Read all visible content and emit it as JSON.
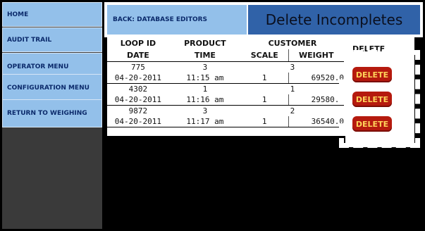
{
  "sidebar": {
    "items": [
      {
        "label": "HOME"
      },
      {
        "label": "AUDIT TRAIL"
      },
      {
        "label": "OPERATOR MENU"
      },
      {
        "label": "CONFIGURATION MENU"
      },
      {
        "label": "RETURN TO WEIGHING"
      }
    ]
  },
  "header": {
    "back_label": "BACK: DATABASE EDITORS",
    "title": "Delete Incompletes"
  },
  "table": {
    "headers_top": [
      "LOOP ID",
      "PRODUCT",
      "CUSTOMER",
      "DELETE"
    ],
    "headers_bottom": [
      "DATE",
      "TIME",
      "SCALE",
      "WEIGHT"
    ],
    "rows": [
      {
        "loop_id": "775",
        "product": "3",
        "customer": "3",
        "date": "04-20-2011",
        "time": "11:15 am",
        "scale": "1",
        "weight": "69520.0"
      },
      {
        "loop_id": "4302",
        "product": "1",
        "customer": "1",
        "date": "04-20-2011",
        "time": "11:16 am",
        "scale": "1",
        "weight": "29580.0"
      },
      {
        "loop_id": "9872",
        "product": "3",
        "customer": "2",
        "date": "04-20-2011",
        "time": "11:17 am",
        "scale": "1",
        "weight": "36540.0"
      }
    ],
    "delete_label": "DELETE"
  },
  "colors": {
    "nav": "#93c0ea",
    "title_bg": "#3062a8",
    "delete_bg": "#b51a0e",
    "delete_text": "#ffd35a"
  }
}
